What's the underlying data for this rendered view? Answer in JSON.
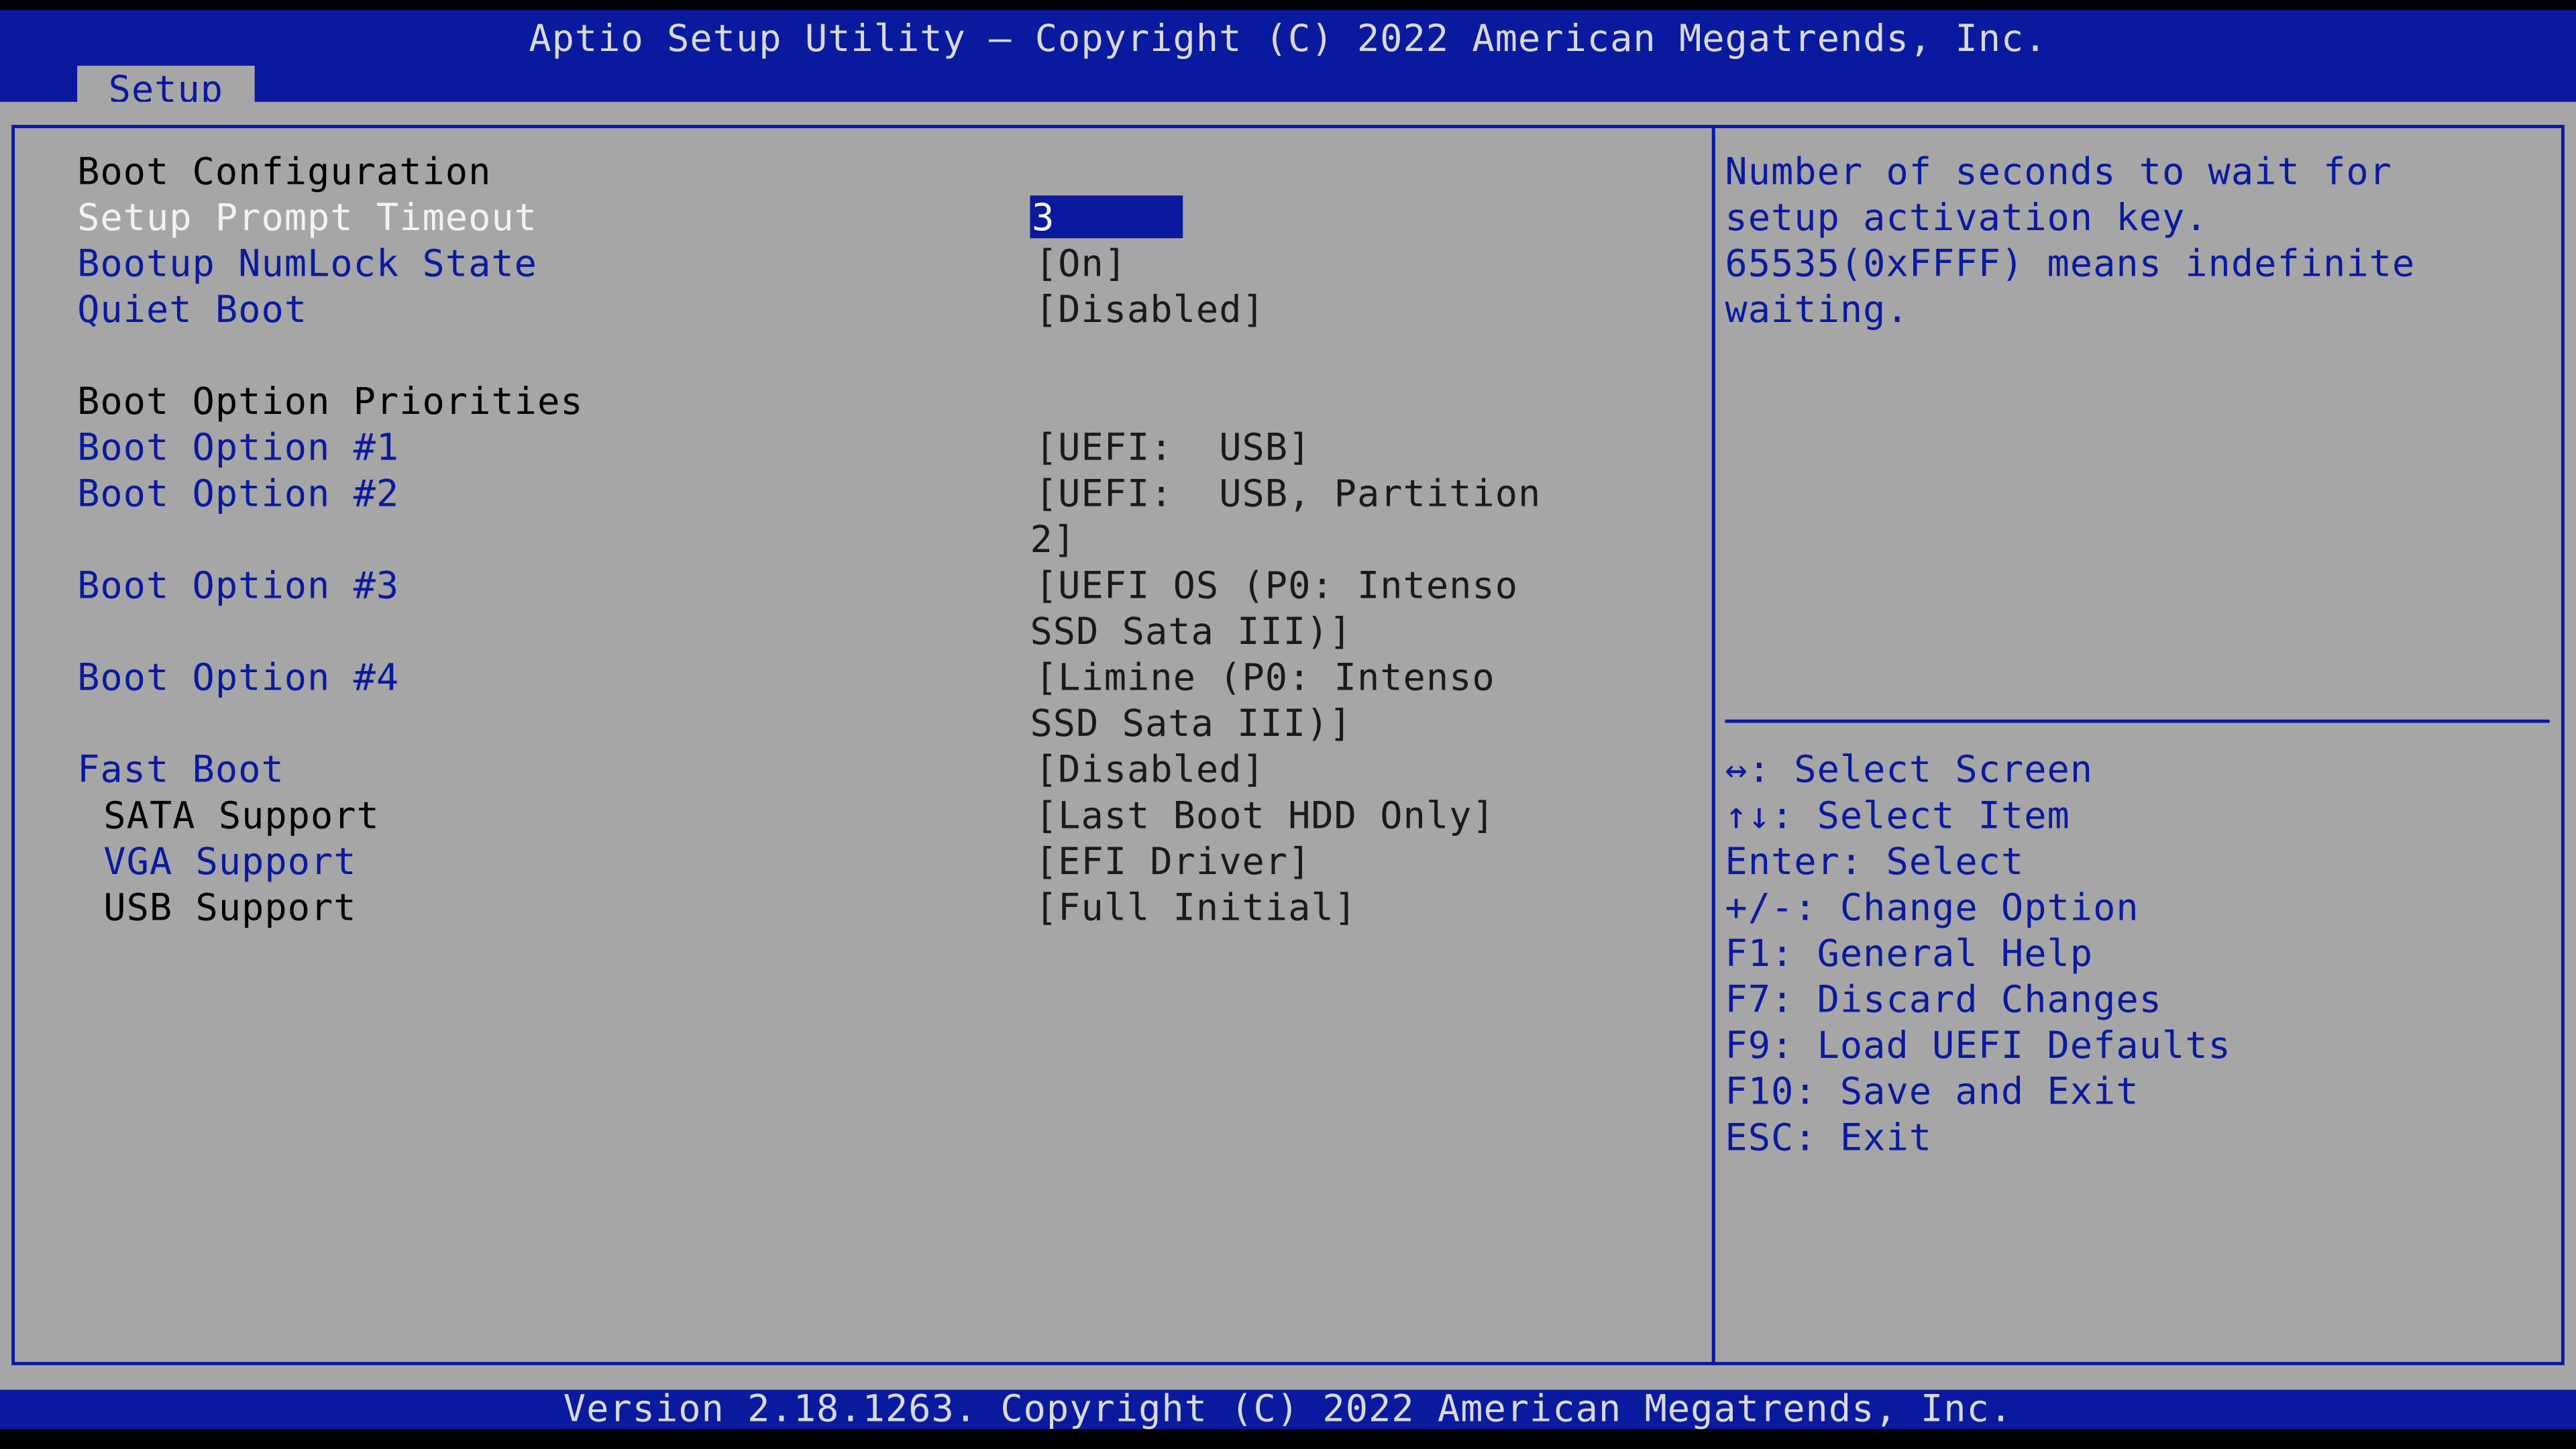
{
  "header": {
    "title": "Aptio Setup Utility – Copyright (C) 2022 American Megatrends, Inc.",
    "tab": "Setup"
  },
  "boot_configuration": {
    "heading": "Boot Configuration",
    "setup_prompt_timeout": {
      "label": "Setup Prompt Timeout",
      "value": "3"
    },
    "bootup_numlock_state": {
      "label": "Bootup NumLock State",
      "value": "[On]"
    },
    "quiet_boot": {
      "label": "Quiet Boot",
      "value": "[Disabled]"
    }
  },
  "boot_option_priorities": {
    "heading": "Boot Option Priorities",
    "options": [
      {
        "label": "Boot Option #1",
        "value_lines": [
          "[UEFI:  USB]"
        ]
      },
      {
        "label": "Boot Option #2",
        "value_lines": [
          "[UEFI:  USB, Partition",
          "2]"
        ]
      },
      {
        "label": "Boot Option #3",
        "value_lines": [
          "[UEFI OS (P0: Intenso",
          "SSD Sata III)]"
        ]
      },
      {
        "label": "Boot Option #4",
        "value_lines": [
          "[Limine (P0: Intenso",
          "SSD Sata III)]"
        ]
      }
    ]
  },
  "fast_boot": {
    "label": "Fast Boot",
    "value": "[Disabled]",
    "sata_support": {
      "label": "SATA Support",
      "value": "[Last Boot HDD Only]"
    },
    "vga_support": {
      "label": "VGA Support",
      "value": "[EFI Driver]"
    },
    "usb_support": {
      "label": "USB Support",
      "value": "[Full Initial]"
    }
  },
  "help": {
    "lines": [
      "Number of seconds to wait for",
      "setup activation key.",
      "65535(0xFFFF) means indefinite",
      "waiting."
    ]
  },
  "keys": [
    "↔: Select Screen",
    "↑↓: Select Item",
    "Enter: Select",
    "+/-: Change Option",
    "F1: General Help",
    "F7: Discard Changes",
    "F9: Load UEFI Defaults",
    "F10: Save and Exit",
    "ESC: Exit"
  ],
  "footer": {
    "version": "Version 2.18.1263. Copyright (C) 2022 American Megatrends, Inc."
  },
  "colors": {
    "bios_blue": "#0a1a9e",
    "panel_gray": "#a6a6a6",
    "highlight_white": "#f2f2f2"
  }
}
